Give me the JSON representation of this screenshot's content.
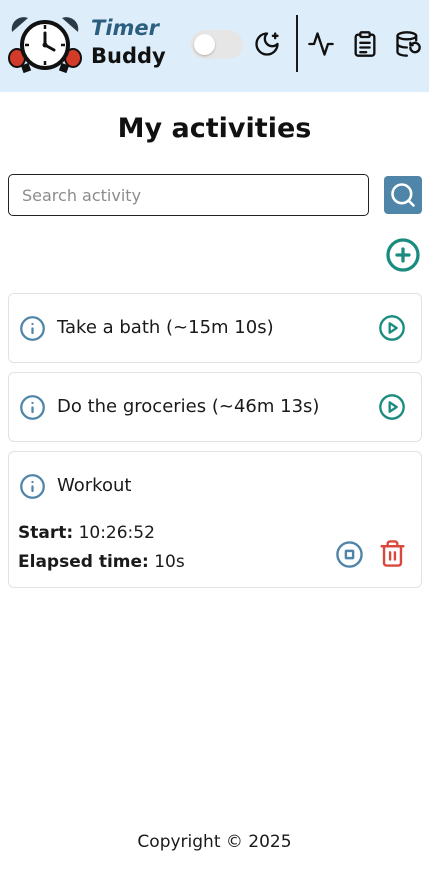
{
  "header": {
    "brand_line1": "Timer",
    "brand_line2": "Buddy",
    "dark_mode_enabled": false
  },
  "page_title": "My activities",
  "search": {
    "placeholder": "Search activity",
    "value": ""
  },
  "activities": [
    {
      "name": "Take a bath (~15m 10s)",
      "state": "idle"
    },
    {
      "name": "Do the groceries (~46m 13s)",
      "state": "idle"
    },
    {
      "name": "Workout",
      "state": "running",
      "start_label": "Start:",
      "start_value": "10:26:52",
      "elapsed_label": "Elapsed time:",
      "elapsed_value": "10s"
    }
  ],
  "footer": {
    "copyright": "Copyright © 2025"
  },
  "colors": {
    "header_bg": "#ddeefa",
    "brand_blue": "#2c5f7f",
    "accent_teal": "#1a8c7f",
    "info_blue": "#4e85a8",
    "danger": "#d9483b"
  },
  "icons": [
    "alarm-clock-logo",
    "moon-icon",
    "activity-icon",
    "clipboard-icon",
    "database-history-icon",
    "search-icon",
    "plus-circle-icon",
    "info-icon",
    "play-icon",
    "stop-icon",
    "trash-icon"
  ]
}
